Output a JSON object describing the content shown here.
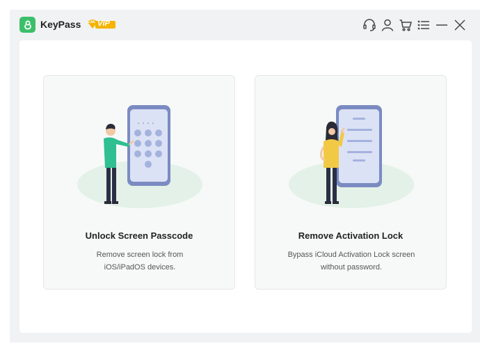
{
  "app": {
    "name": "KeyPass",
    "badge": "VIP"
  },
  "window_controls": [
    {
      "name": "support-icon"
    },
    {
      "name": "account-icon"
    },
    {
      "name": "cart-icon"
    },
    {
      "name": "menu-icon"
    },
    {
      "name": "minimize-icon"
    },
    {
      "name": "close-icon"
    }
  ],
  "cards": [
    {
      "title": "Unlock Screen Passcode",
      "desc_line1": "Remove screen lock from",
      "desc_line2": "iOS/iPadOS devices."
    },
    {
      "title": "Remove Activation Lock",
      "desc_line1": "Bypass iCloud Activation Lock screen",
      "desc_line2": "without password."
    }
  ],
  "colors": {
    "brand": "#3bbf6a",
    "vip": "#f5b400",
    "phone": "#7b8bc2"
  }
}
